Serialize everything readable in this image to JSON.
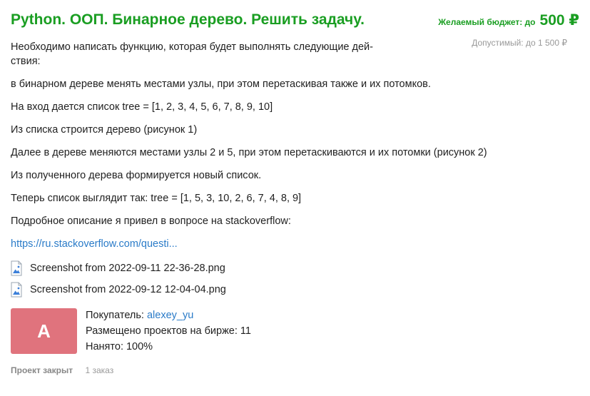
{
  "title": "Python. ООП. Бинарное дерево. Решить задачу.",
  "budget": {
    "label": "Желаемый бюджет: до",
    "amount": "500 ₽",
    "max": "Допустимый: до 1 500 ₽"
  },
  "description": {
    "intro": "Необходимо написать функцию, которая будет выполнять следующие дей-ствия:",
    "paragraphs": [
      "в бинарном дереве менять местами узлы, при этом перетаскивая также и их потомков.",
      "На вход дается список tree = [1, 2, 3, 4, 5, 6, 7, 8, 9, 10]",
      "Из списка строится дерево (рисунок 1)",
      "Далее в дереве меняются местами узлы 2 и 5, при этом перетаскиваются и их потомки (рисунок 2)",
      "Из полученного дерева формируется новый список.",
      "Теперь список выглядит так: tree = [1, 5, 3, 10, 2, 6, 7, 4, 8, 9]",
      "Подробное описание я привел в вопросе на stackoverflow:"
    ],
    "link": "https://ru.stackoverflow.com/questi..."
  },
  "files": [
    {
      "name": "Screenshot from 2022-09-11 22-36-28.png",
      "icon": "image-file-icon"
    },
    {
      "name": "Screenshot from 2022-09-12 12-04-04.png",
      "icon": "image-file-icon"
    }
  ],
  "buyer": {
    "avatar_letter": "A",
    "avatar_color": "#e0737d",
    "label": "Покупатель:",
    "name": "alexey_yu",
    "projects": "Размещено проектов на бирже: 11",
    "hired": "Нанято: 100%"
  },
  "footer": {
    "status": "Проект закрыт",
    "orders": "1 заказ"
  },
  "colors": {
    "accent": "#1a9e22",
    "link": "#2a7bc8"
  }
}
